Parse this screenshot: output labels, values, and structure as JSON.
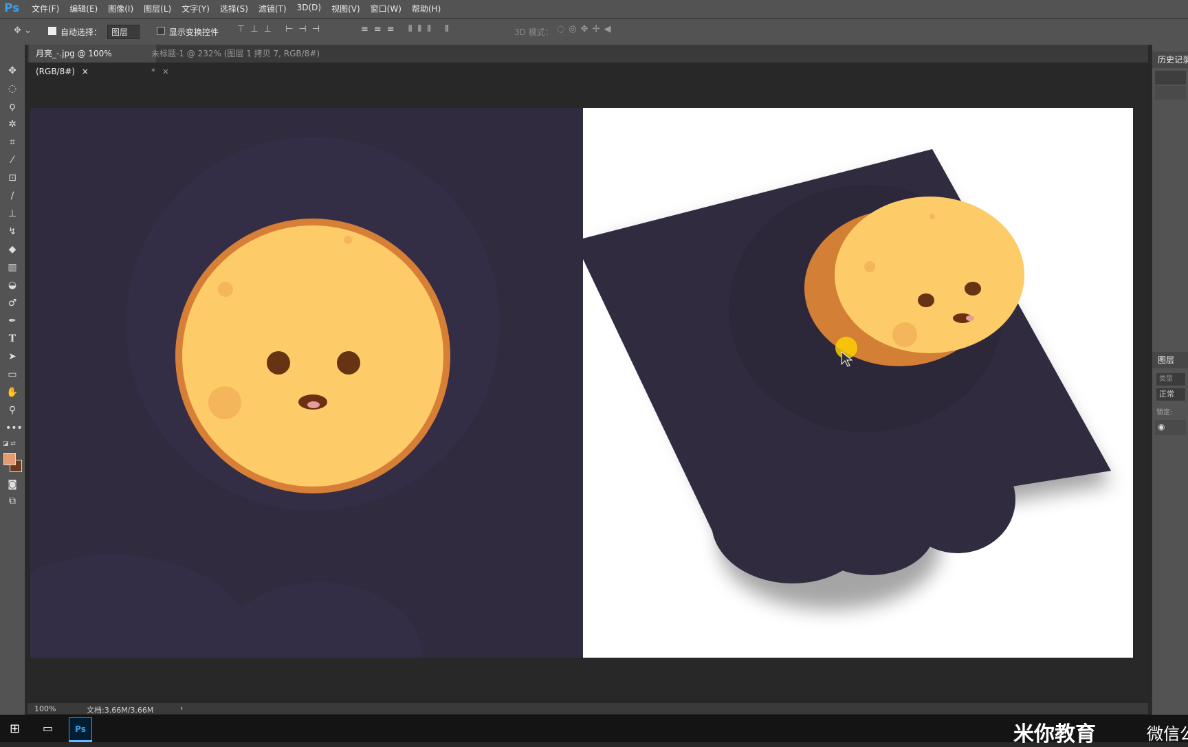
{
  "app": {
    "logo": "Ps"
  },
  "menu": [
    "文件(F)",
    "编辑(E)",
    "图像(I)",
    "图层(L)",
    "文字(Y)",
    "选择(S)",
    "滤镜(T)",
    "3D(D)",
    "视图(V)",
    "窗口(W)",
    "帮助(H)"
  ],
  "options": {
    "auto_select_label": "自动选择：",
    "auto_select_value": "图层",
    "transform_label": "显示变换控件",
    "mode_3d_label": "3D 模式："
  },
  "tabs": [
    {
      "label": "月亮_-.jpg @ 100%(RGB/8#)",
      "close": "×"
    },
    {
      "label": "未标题-1 @ 232% (图层 1 拷贝 7, RGB/8#) *",
      "close": "×"
    }
  ],
  "status": {
    "zoom": "100%",
    "doc": "文档:3.66M/3.66M",
    "arrow": "›"
  },
  "panels": {
    "history": "历史记录",
    "layers": "图层",
    "type_search": "类型",
    "blend_mode": "正常",
    "lock_label": "锁定:"
  },
  "taskbar": {
    "ps_label": "Ps",
    "watermark": "米你教育",
    "watermark2": "微信公"
  },
  "colors": {
    "foreground": "#e59a6f",
    "background": "#6b3a1c",
    "canvas_bg": "#302b3f",
    "moon_fill": "#fdcb67",
    "moon_rim": "#d77f36"
  }
}
